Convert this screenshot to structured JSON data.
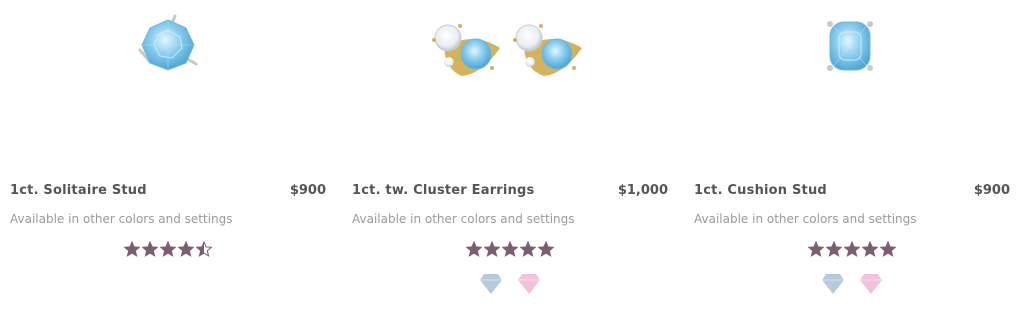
{
  "products": [
    {
      "name": "1ct. Solitaire Stud",
      "price": "$900",
      "availability": "Available in other colors and settings",
      "image_icon": "solitaire-stud-earring-icon",
      "rating": 4.5,
      "swatches": []
    },
    {
      "name": "1ct. tw. Cluster Earrings",
      "price": "$1,000",
      "availability": "Available in other colors and settings",
      "image_icon": "cluster-earrings-icon",
      "rating": 5,
      "swatches": [
        {
          "icon": "diamond-swatch-icon",
          "color": "#b5cadb"
        },
        {
          "icon": "diamond-swatch-icon",
          "color": "#f2c1de"
        }
      ]
    },
    {
      "name": "1ct. Cushion Stud",
      "price": "$900",
      "availability": "Available in other colors and settings",
      "image_icon": "cushion-stud-earring-icon",
      "rating": 5,
      "swatches": [
        {
          "icon": "diamond-swatch-icon",
          "color": "#b5cadb"
        },
        {
          "icon": "diamond-swatch-icon",
          "color": "#f2c1de"
        }
      ]
    }
  ],
  "colors": {
    "star": "#7d5d72",
    "gem_blue": "#8fd0ee",
    "gem_blue_dark": "#4aa3d4",
    "gold": "#d6b25a",
    "silver": "#c9c9c9"
  }
}
